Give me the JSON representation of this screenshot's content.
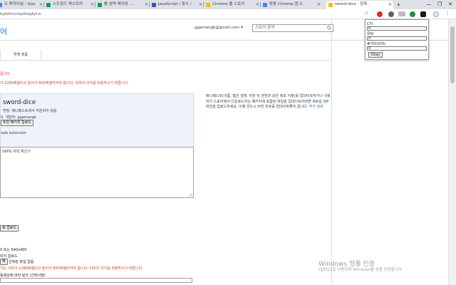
{
  "tabs": [
    {
      "label": "도 뽀하이실 - Goo",
      "color": "#4285f4"
    },
    {
      "label": "스트림드 퍼스트라",
      "color": "#0f9d58"
    },
    {
      "label": "롤 엄택 케이밍 ...",
      "color": "#0f9d58"
    },
    {
      "label": "JavaScript / 함수 /",
      "color": "#3f51b5"
    },
    {
      "label": "Chrome 웹 스토어",
      "color": "#fbbc05"
    },
    {
      "label": "맞춤 Chrome 앱 스",
      "color": "#4285f4"
    },
    {
      "label": "sword-dice - 항목",
      "color": "#fbbc05"
    }
  ],
  "new_tab_label": "+",
  "window_controls": {
    "minimize": "—",
    "maximize": "❐",
    "close": "✕"
  },
  "address": {
    "url": "kgfpthonkpdkogkjlca"
  },
  "header": {
    "logo": "어",
    "account": "ggamangk@gmail.com ▾",
    "search_placeholder": "스토어 검색"
  },
  "tab_label": "연맹 제품",
  "warnings": {
    "w1": "됩니다.",
    "w2": "가 1280픽셀이고 높이가 800픽셀이어야 합니다. 이미지 크기를 조정하시기 바랍니다."
  },
  "package": {
    "name": "sword-dice",
    "subtitle": "변정: 매니페스트에서 지원되지 않음",
    "by": "0. 개발자: ggamangk",
    "upload_button": "트한 패키지 업로드",
    "type": "web extension"
  },
  "side_text": {
    "body": "매니페스트(이름, 짧은 설명, 버전 및 권한과 같은 정보 지정)를 업데이트하거나 사용자가 스토어에서 다운로드하는 패키지에 포함된 파일을 업데이트하려면 새로운 ZIP 파일을 업로드하세요. 이때 반드시 버전 번호를 업데이트해야 합니다.",
    "link": "추가 정보"
  },
  "description_label": "1RPG 유학 계산기",
  "upload_button2": "로 업로드",
  "image": {
    "size_note": "0 또는 640x400",
    "upload_label": "미지 업로드",
    "choose_button": "해",
    "file_status": "선택된 파일 없음",
    "warning": "가는 너비가 1280픽셀이고 높이가 800픽셀이어야 합니다. 이미지 크기를 조정하시기 바랍니다.",
    "link_label": "동영상에 대한 링크 (선택사항)"
  },
  "watermark": {
    "title": "Windows 정품 인증",
    "subtitle": "[설정]으로 이동하여 Windows를 정품 인증합니다."
  },
  "popup": {
    "f1_label": "C지",
    "f1_value": "0",
    "f2_label": "뮤턱",
    "f2_value": "0",
    "f3_label": "#거리(미지)",
    "f3_value": "0",
    "ok_label": "Okay"
  }
}
